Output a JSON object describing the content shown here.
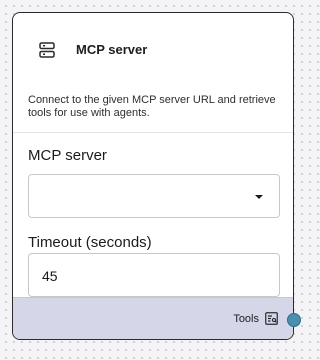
{
  "node": {
    "title": "MCP server",
    "icon": "server-icon",
    "description": "Connect to the given MCP server URL and retrieve tools for use with agents."
  },
  "fields": {
    "server": {
      "label": "MCP server",
      "value": ""
    },
    "timeout": {
      "label": "Timeout (seconds)",
      "value": "45"
    }
  },
  "footer": {
    "output_label": "Tools",
    "output_icon": "tools-icon"
  },
  "colors": {
    "footer_bg": "#d5d7e8",
    "handle": "#4a90ad"
  }
}
